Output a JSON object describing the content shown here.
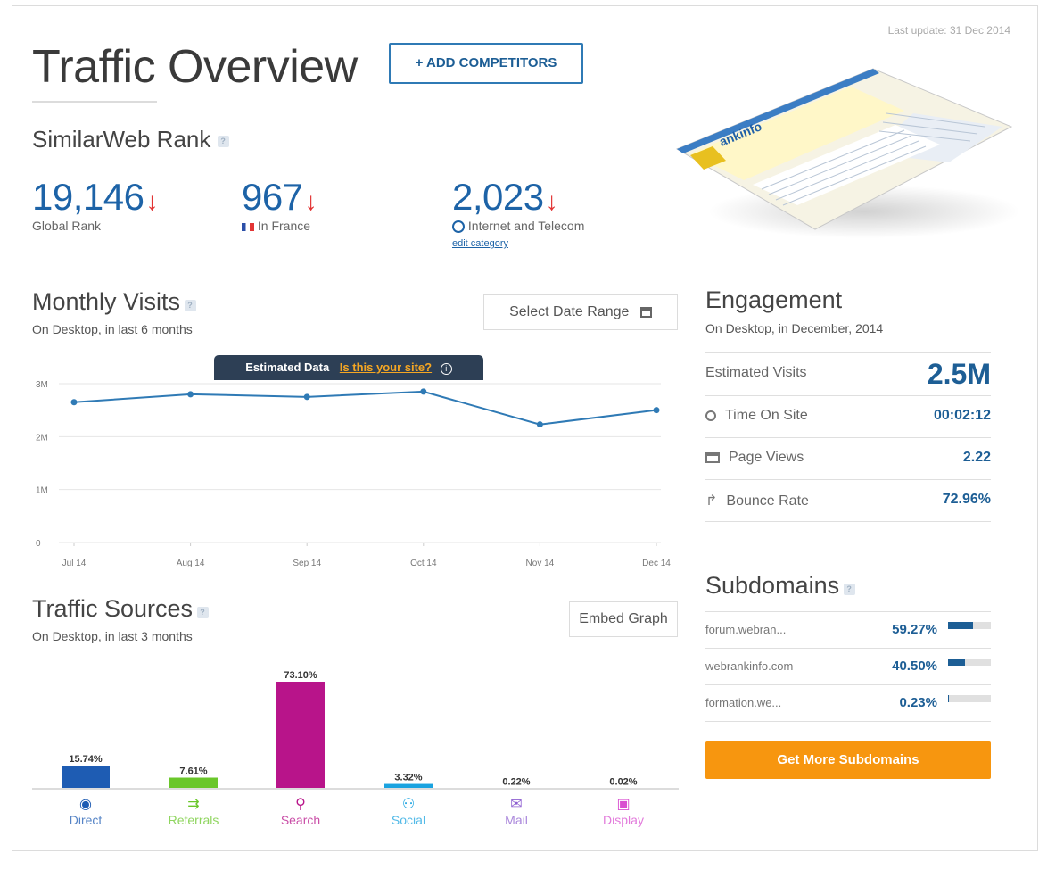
{
  "header": {
    "title": "Traffic Overview",
    "add_competitors": "+ ADD COMPETITORS",
    "last_update": "Last update: 31 Dec 2014"
  },
  "rank": {
    "title": "SimilarWeb Rank",
    "global": {
      "value": "19,146",
      "label": "Global Rank",
      "trend": "down"
    },
    "country": {
      "value": "967",
      "label": "In France",
      "trend": "down"
    },
    "category": {
      "value": "2,023",
      "label": "Internet and Telecom",
      "trend": "down",
      "edit": "edit category"
    }
  },
  "site_preview": {
    "logo_text": "ankinfo"
  },
  "monthly_visits": {
    "title": "Monthly Visits",
    "subtitle": "On Desktop, in last 6 months",
    "date_range_button": "Select Date Range",
    "estimated_label": "Estimated Data",
    "estimated_link": "Is this your site?"
  },
  "chart_data": [
    {
      "type": "line",
      "x": [
        "Jul 14",
        "Aug 14",
        "Sep 14",
        "Oct 14",
        "Nov 14",
        "Dec 14"
      ],
      "series": [
        {
          "values": [
            2650000,
            2800000,
            2750000,
            2850000,
            2230000,
            2500000
          ]
        }
      ],
      "y_ticks": [
        "0",
        "1M",
        "2M",
        "3M"
      ],
      "ylim": [
        0,
        3000000
      ],
      "grid": true,
      "color": "#2f7ab5"
    },
    {
      "type": "bar",
      "categories": [
        "Direct",
        "Referrals",
        "Search",
        "Social",
        "Mail",
        "Display"
      ],
      "values": [
        15.74,
        7.61,
        73.1,
        3.32,
        0.22,
        0.02
      ],
      "labels": [
        "15.74%",
        "7.61%",
        "73.10%",
        "3.32%",
        "0.22%",
        "0.02%"
      ],
      "colors": [
        "#1e5cb3",
        "#6ac72a",
        "#b8148a",
        "#1aa3e0",
        "#8e5fd0",
        "#d94fd0"
      ]
    }
  ],
  "traffic_sources": {
    "title": "Traffic Sources",
    "subtitle": "On Desktop, in last 3 months",
    "embed_button": "Embed Graph"
  },
  "engagement": {
    "title": "Engagement",
    "subtitle": "On Desktop, in December, 2014",
    "rows": [
      {
        "label": "Estimated Visits",
        "value": "2.5M"
      },
      {
        "label": "Time On Site",
        "value": "00:02:12",
        "icon": "clock-icon"
      },
      {
        "label": "Page Views",
        "value": "2.22",
        "icon": "page-icon"
      },
      {
        "label": "Bounce Rate",
        "value": "72.96%",
        "icon": "bounce-icon"
      }
    ]
  },
  "subdomains": {
    "title": "Subdomains",
    "rows": [
      {
        "name": "forum.webran...",
        "pct": "59.27%",
        "share": 0.5927
      },
      {
        "name": "webrankinfo.com",
        "pct": "40.50%",
        "share": 0.405
      },
      {
        "name": "formation.we...",
        "pct": "0.23%",
        "share": 0.0023
      }
    ],
    "cta": "Get More Subdomains"
  },
  "colors": {
    "accent_blue": "#1d63a7",
    "cta_orange": "#f7960f",
    "arrow_red": "#e23434"
  }
}
